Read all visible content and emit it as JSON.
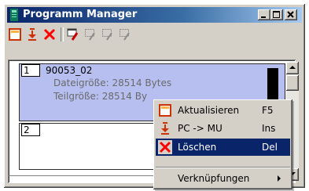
{
  "window": {
    "title": "Programm Manager"
  },
  "toolbar": {
    "buttons": [
      {
        "icon": "refresh-box-icon",
        "color": "#cc3300"
      },
      {
        "icon": "transfer-down-icon",
        "color": "#cc3300"
      },
      {
        "icon": "delete-x-icon",
        "color": "#ff0000"
      },
      {
        "icon": "link-red-icon",
        "color": "#cc0000"
      },
      {
        "icon": "link-disabled-icon"
      },
      {
        "icon": "link-disabled-icon"
      },
      {
        "icon": "link-disabled-icon"
      }
    ]
  },
  "list": {
    "items": [
      {
        "number": "1",
        "name": "90053_02",
        "size_line": "Dateigröße: 28514 Bytes",
        "part_line": "Teilgröße: 28514 By",
        "selected": true
      },
      {
        "number": "2"
      }
    ]
  },
  "context_menu": {
    "items": [
      {
        "label": "Aktualisieren",
        "shortcut": "F5",
        "icon": "refresh-box-icon"
      },
      {
        "label": "PC -> MU",
        "shortcut": "Ins",
        "icon": "transfer-down-icon"
      },
      {
        "label": "Löschen",
        "shortcut": "Del",
        "icon": "delete-x-icon",
        "highlighted": true
      },
      {
        "label": "Verknüpfungen",
        "submenu": true
      }
    ]
  },
  "colors": {
    "titlebar": "#0a246a",
    "selection_bg": "#b6bff0",
    "menu_highlight": "#0a246a",
    "icon_red": "#cc3300"
  }
}
